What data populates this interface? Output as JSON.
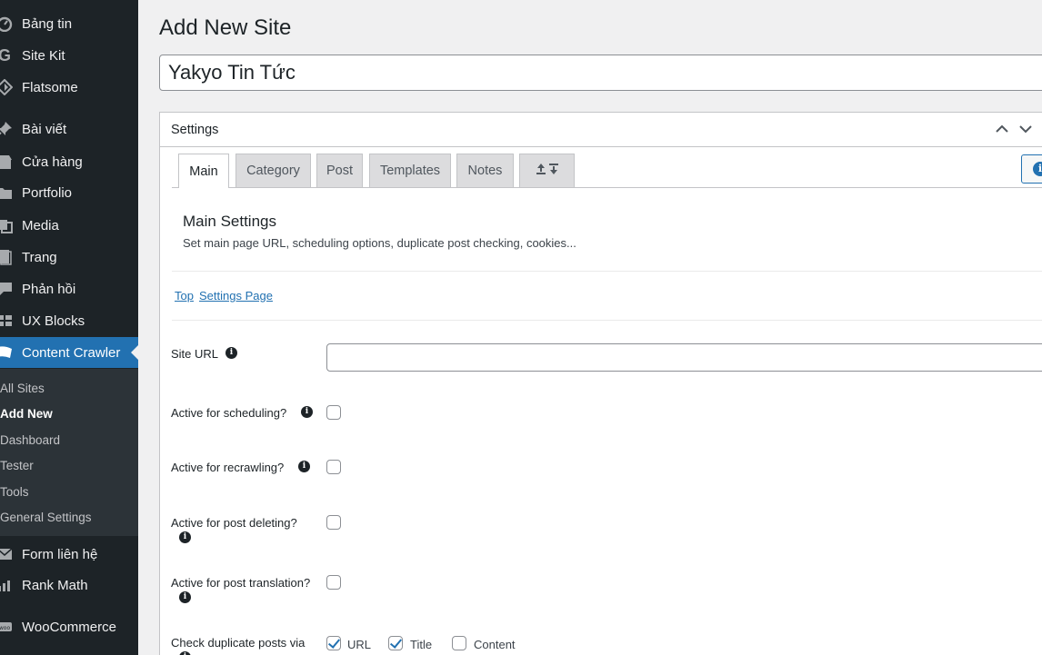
{
  "sidebar": {
    "items": [
      {
        "label": "Bảng tin",
        "icon": "dashboard-icon"
      },
      {
        "label": "Site Kit",
        "icon": "google-g-icon"
      },
      {
        "label": "Flatsome",
        "icon": "flatsome-icon"
      },
      {
        "label": "Bài viết",
        "icon": "pushpin-icon"
      },
      {
        "label": "Cửa hàng",
        "icon": "store-icon"
      },
      {
        "label": "Portfolio",
        "icon": "folder-icon"
      },
      {
        "label": "Media",
        "icon": "media-icon"
      },
      {
        "label": "Trang",
        "icon": "page-icon"
      },
      {
        "label": "Phản hồi",
        "icon": "comment-icon"
      },
      {
        "label": "UX Blocks",
        "icon": "blocks-icon"
      },
      {
        "label": "Content Crawler",
        "icon": "crawler-icon",
        "active": true
      },
      {
        "label": "Form liên hệ",
        "icon": "mail-icon"
      },
      {
        "label": "Rank Math",
        "icon": "chart-icon"
      },
      {
        "label": "WooCommerce",
        "icon": "woo-icon"
      }
    ],
    "submenu": [
      {
        "label": "All Sites"
      },
      {
        "label": "Add New",
        "current": true
      },
      {
        "label": "Dashboard"
      },
      {
        "label": "Tester"
      },
      {
        "label": "Tools"
      },
      {
        "label": "General Settings"
      }
    ]
  },
  "page": {
    "title": "Add New Site",
    "site_title_value": "Yakyo Tin Tức"
  },
  "settings": {
    "box_title": "Settings",
    "tabs": [
      {
        "label": "Main",
        "active": true
      },
      {
        "label": "Category"
      },
      {
        "label": "Post"
      },
      {
        "label": "Templates"
      },
      {
        "label": "Notes"
      },
      {
        "label": "⇪ ⇩",
        "icon": "import-export-icon"
      }
    ],
    "section_title": "Main Settings",
    "section_desc": "Set main page URL, scheduling options, duplicate post checking, cookies...",
    "links": [
      "Top",
      "Settings Page"
    ],
    "fields": {
      "site_url_label": "Site URL",
      "site_url_value": "",
      "scheduling_label": "Active for scheduling?",
      "scheduling_checked": false,
      "recrawling_label": "Active for recrawling?",
      "recrawling_checked": false,
      "deleting_label": "Active for post deleting?",
      "deleting_checked": false,
      "translation_label": "Active for post translation?",
      "translation_checked": false,
      "duplicate_label": "Check duplicate posts via",
      "duplicate_options": [
        {
          "label": "URL",
          "checked": true
        },
        {
          "label": "Title",
          "checked": true
        },
        {
          "label": "Content",
          "checked": false
        }
      ]
    }
  }
}
